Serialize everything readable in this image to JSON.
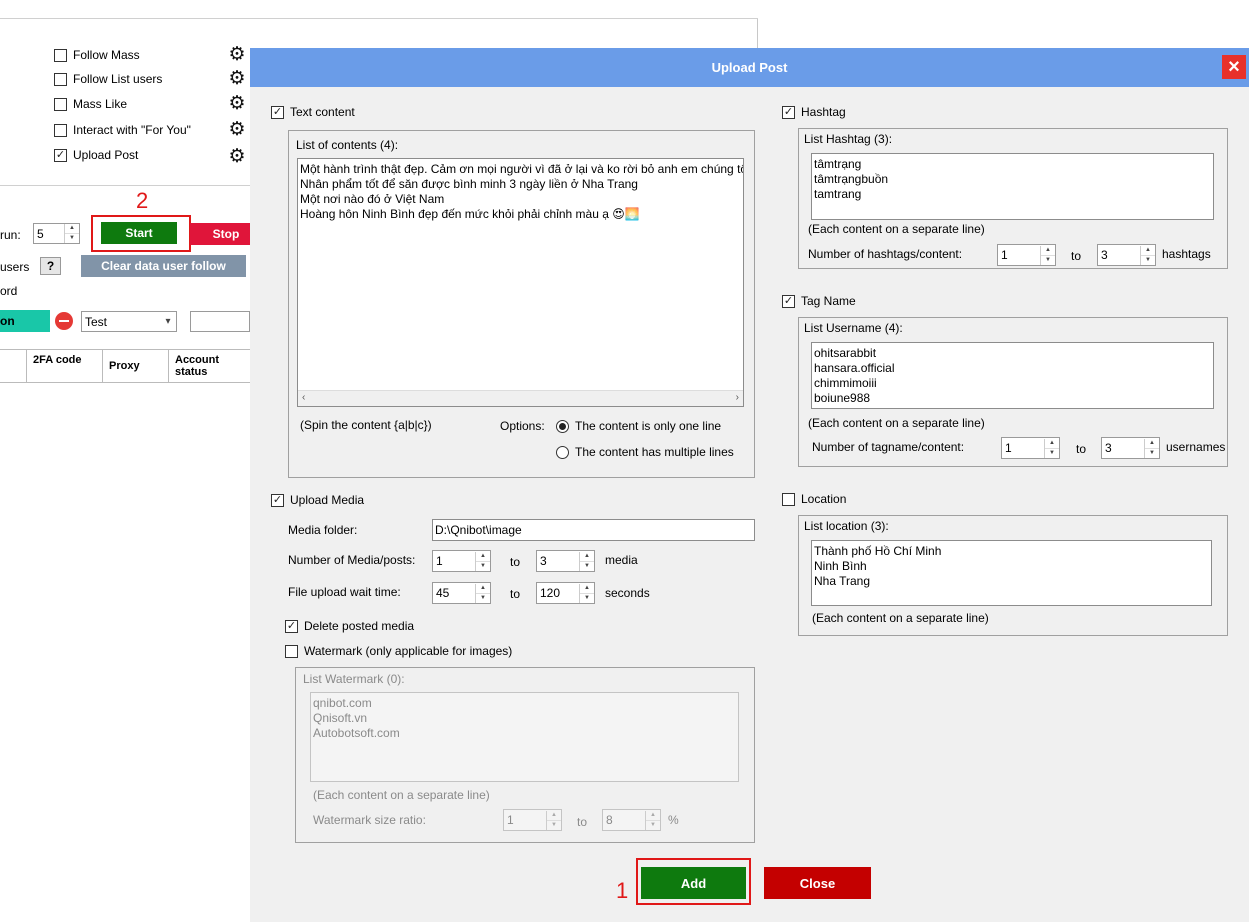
{
  "background": {
    "functions": [
      {
        "label": "Follow Mass",
        "checked": false
      },
      {
        "label": "Follow List users",
        "checked": false
      },
      {
        "label": "Mass Like",
        "checked": false
      },
      {
        "label": "Interact with \"For You\"",
        "checked": false
      },
      {
        "label": "Upload Post",
        "checked": true
      }
    ],
    "run_label": "run:",
    "run_value": "5",
    "start_label": "Start",
    "stop_label": "Stop",
    "users_label": "users",
    "help_label": "?",
    "clear_label": "Clear data user follow",
    "word_label": "ord",
    "on_label": "on",
    "select_value": "Test",
    "table_headers": [
      "2FA code",
      "Proxy",
      "Account status"
    ]
  },
  "annotations": {
    "one": "1",
    "two": "2"
  },
  "dialog": {
    "title": "Upload Post",
    "close_icon": "×",
    "text_content": {
      "label": "Text content",
      "checked": true,
      "list_caption": "List of contents (4):",
      "lines": [
        "Một hành trình thật đẹp. Cảm ơn mọi người vì đã ở lại và ko rời bỏ anh em chúng tô",
        "Nhân phẩm tốt để săn được bình minh 3 ngày liền ở Nha Trang",
        "Một nơi nào đó ở Việt Nam",
        "Hoàng hôn Ninh Bình đẹp đến mức khỏi phải chỉnh màu ạ 😍🌅"
      ],
      "spin_hint": "(Spin the content {a|b|c})",
      "options_label": "Options:",
      "option_one": "The content is only one line",
      "option_multi": "The content has multiple lines"
    },
    "hashtag": {
      "label": "Hashtag",
      "checked": true,
      "list_caption": "List Hashtag (3):",
      "lines": [
        "tâmtrạng",
        "tâmtrạngbuồn",
        "tamtrang"
      ],
      "hint": "(Each content on a separate line)",
      "count_label": "Number of hashtags/content:",
      "from": "1",
      "to_label": "to",
      "to": "3",
      "unit": "hashtags"
    },
    "tag_name": {
      "label": "Tag Name",
      "checked": true,
      "list_caption": "List Username (4):",
      "lines": [
        "ohitsarabbit",
        "hansara.official",
        "chimmimoiii",
        "boiune988"
      ],
      "hint": "(Each content on a separate line)",
      "count_label": "Number of tagname/content:",
      "from": "1",
      "to_label": "to",
      "to": "3",
      "unit": "usernames"
    },
    "upload_media": {
      "label": "Upload Media",
      "checked": true,
      "folder_label": "Media folder:",
      "folder_value": "D:\\Qnibot\\image",
      "count_label": "Number of Media/posts:",
      "count_from": "1",
      "to_label": "to",
      "count_to": "3",
      "count_unit": "media",
      "wait_label": "File upload wait time:",
      "wait_from": "45",
      "wait_to": "120",
      "wait_unit": "seconds",
      "delete_label": "Delete posted media",
      "delete_checked": true,
      "watermark_label": "Watermark (only applicable for images)",
      "watermark_checked": false,
      "wm_caption": "List Watermark (0):",
      "wm_lines": [
        "qnibot.com",
        "Qnisoft.vn",
        "Autobotsoft.com"
      ],
      "wm_hint": "(Each content on a separate line)",
      "wm_ratio_label": "Watermark size ratio:",
      "wm_from": "1",
      "wm_to": "8",
      "wm_unit": "%"
    },
    "location": {
      "label": "Location",
      "checked": false,
      "list_caption": "List location (3):",
      "lines": [
        "Thành phố Hồ Chí Minh",
        "Ninh Bình",
        "Nha Trang"
      ],
      "hint": "(Each content on a separate line)"
    },
    "add_label": "Add",
    "close_label": "Close"
  },
  "colors": {
    "title_bar": "#6a9ce8",
    "start": "#0e7a0e",
    "stop": "#e0153a",
    "add": "#0e7a0e",
    "close": "#c40000",
    "highlight": "#e01818"
  }
}
